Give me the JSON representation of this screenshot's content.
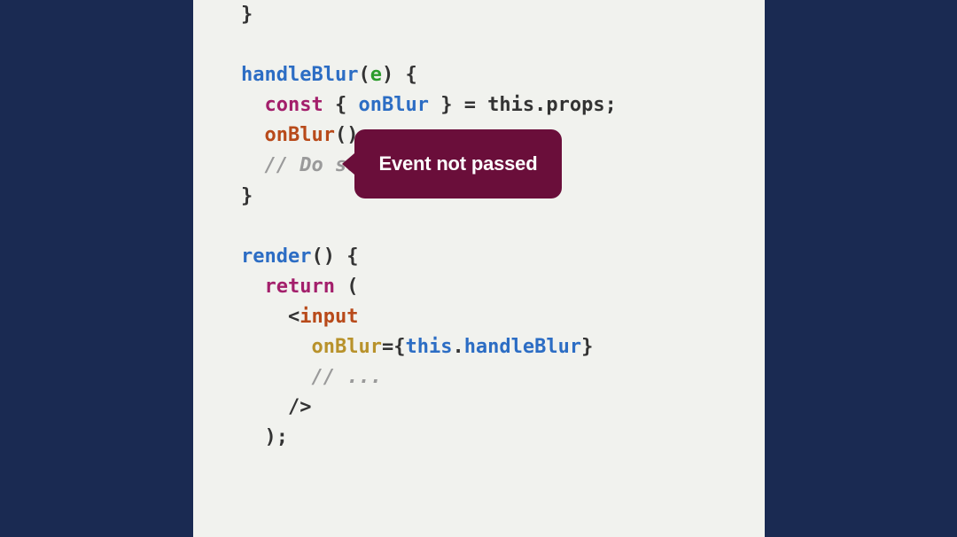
{
  "code": {
    "closeBrace1": "}",
    "handleBlurFn": "handleBlur",
    "handleBlurParam": "e",
    "handleBlurParenOpen": "(",
    "handleBlurParenClose": ") ",
    "handleBlurBraceOpen": "{",
    "constKw": "const",
    "destructOpen": " { ",
    "destructVar": "onBlur",
    "destructRest": " } = this.props;",
    "onBlurCall": "onBlur",
    "onBlurCallParens": "();",
    "comment1": "// Do some",
    "closeBrace2": "}",
    "renderFn": "render",
    "renderParens": "() ",
    "renderBraceOpen": "{",
    "returnKw": "return",
    "returnParen": " (",
    "tagOpen": "<",
    "tagName": "input",
    "attrName": "onBlur",
    "attrEq": "=",
    "attrBraceOpen": "{",
    "attrThis": "this",
    "attrDot": ".",
    "attrHandle": "handleBlur",
    "attrBraceClose": "}",
    "comment2": "// ...",
    "tagClose": "/>",
    "closeParen": ");"
  },
  "tooltip": {
    "text": "Event not passed"
  }
}
